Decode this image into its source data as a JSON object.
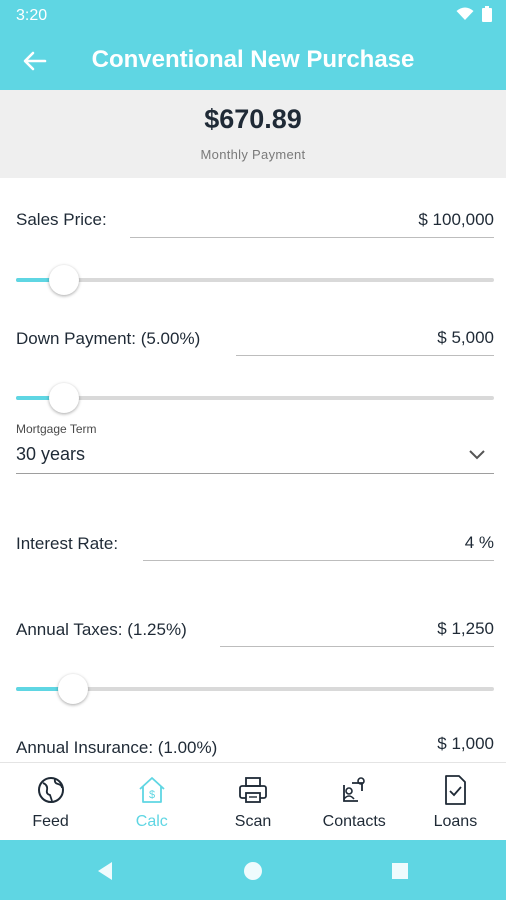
{
  "status": {
    "time": "3:20"
  },
  "header": {
    "title": "Conventional New Purchase"
  },
  "summary": {
    "amount": "$670.89",
    "label": "Monthly Payment"
  },
  "form": {
    "sales_price": {
      "label": "Sales Price:",
      "value": "$ 100,000",
      "slider_level": 0.1
    },
    "down_payment": {
      "label": "Down Payment: (5.00%)",
      "value": "$ 5,000",
      "slider_level": 0.1
    },
    "mortgage_term": {
      "caption": "Mortgage Term",
      "value": "30 years"
    },
    "interest_rate": {
      "label": "Interest Rate:",
      "value": "4 %"
    },
    "annual_taxes": {
      "label": "Annual Taxes: (1.25%)",
      "value": "$ 1,250",
      "slider_level": 0.12
    },
    "annual_insurance": {
      "label": "Annual Insurance: (1.00%)",
      "value": "$ 1,000"
    }
  },
  "bottom_nav": {
    "items": [
      {
        "label": "Feed",
        "icon": "globe-icon"
      },
      {
        "label": "Calc",
        "icon": "house-dollar-icon",
        "active": true
      },
      {
        "label": "Scan",
        "icon": "printer-icon"
      },
      {
        "label": "Contacts",
        "icon": "contacts-icon"
      },
      {
        "label": "Loans",
        "icon": "document-check-icon"
      }
    ]
  },
  "colors": {
    "accent": "#5fd6e3",
    "text": "#1f2a36",
    "summary_bg": "#efefef"
  }
}
